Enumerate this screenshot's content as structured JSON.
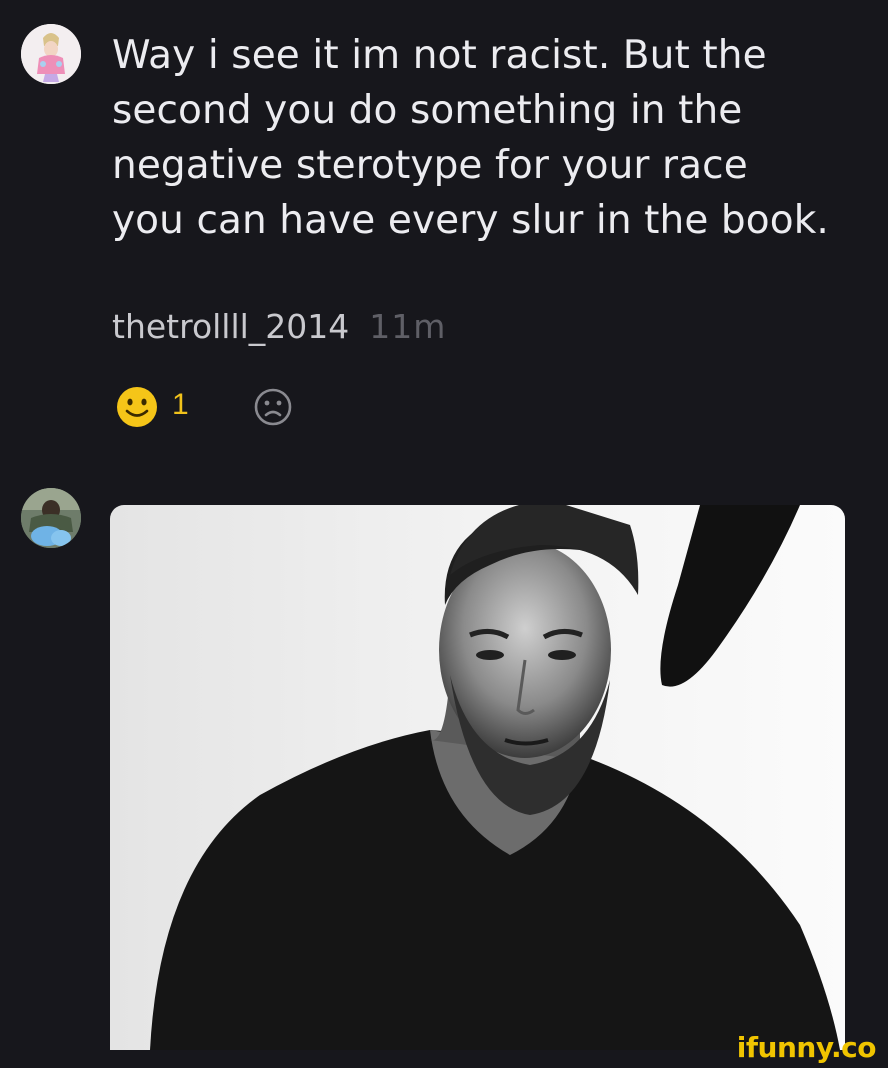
{
  "comment": {
    "text": "Way i see it im not racist. But the second you do something in the negative sterotype for your race you can have every slur in the book.",
    "username": "thetrollll_2014",
    "time": "11m",
    "smile_count": "1"
  },
  "watermark": "ifunny.co",
  "icons": {
    "smile": "smile-emoji-icon",
    "frown": "frown-emoji-icon"
  },
  "colors": {
    "background": "#17171c",
    "accent": "#f1c21b",
    "muted": "#5f5f66"
  }
}
